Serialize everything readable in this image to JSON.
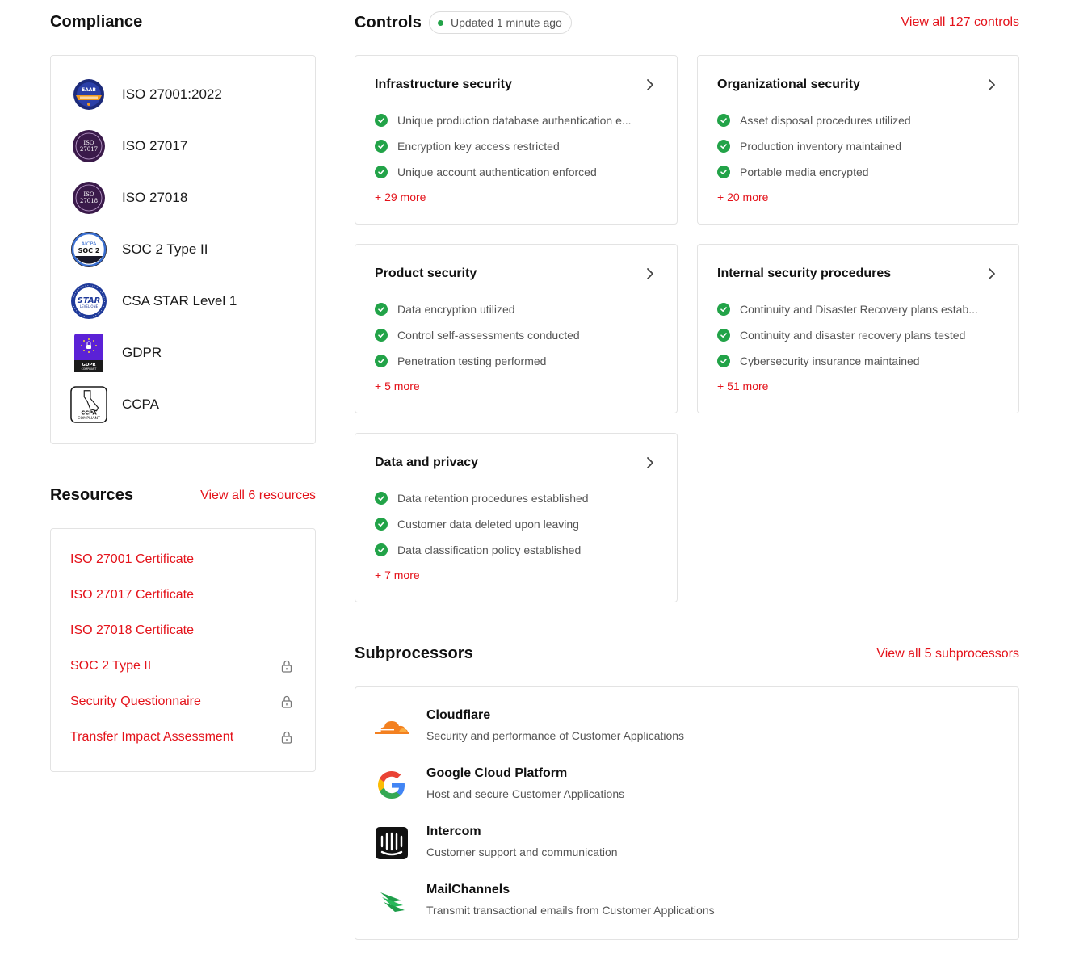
{
  "compliance": {
    "title": "Compliance",
    "items": [
      {
        "label": "ISO 27001:2022",
        "icon": "iso-27001-badge-icon"
      },
      {
        "label": "ISO 27017",
        "icon": "iso-27017-badge-icon"
      },
      {
        "label": "ISO 27018",
        "icon": "iso-27018-badge-icon"
      },
      {
        "label": "SOC 2 Type II",
        "icon": "soc2-badge-icon"
      },
      {
        "label": "CSA STAR Level 1",
        "icon": "csa-star-badge-icon"
      },
      {
        "label": "GDPR",
        "icon": "gdpr-badge-icon"
      },
      {
        "label": "CCPA",
        "icon": "ccpa-badge-icon"
      }
    ],
    "badges": {
      "iso27001_top": "EAAB",
      "iso27017_a": "ISO",
      "iso27017_b": "27017",
      "iso27018_a": "ISO",
      "iso27018_b": "27018",
      "soc_a": "AICPA",
      "soc_b": "SOC 2",
      "star_a": "STAR",
      "star_b": "LEVEL ONE",
      "gdpr_a": "GDPR",
      "gdpr_b": "COMPLIANT",
      "ccpa_a": "CCPA",
      "ccpa_b": "COMPLIANT"
    }
  },
  "resources": {
    "title": "Resources",
    "view_all": "View all 6 resources",
    "items": [
      {
        "label": "ISO 27001 Certificate",
        "locked": false
      },
      {
        "label": "ISO 27017 Certificate",
        "locked": false
      },
      {
        "label": "ISO 27018 Certificate",
        "locked": false
      },
      {
        "label": "SOC 2 Type II",
        "locked": true
      },
      {
        "label": "Security Questionnaire",
        "locked": true
      },
      {
        "label": "Transfer Impact Assessment",
        "locked": true
      }
    ]
  },
  "controls": {
    "title": "Controls",
    "updated": "Updated 1 minute ago",
    "view_all": "View all 127 controls",
    "cards": [
      {
        "title": "Infrastructure security",
        "items": [
          "Unique production database authentication e...",
          "Encryption key access restricted",
          "Unique account authentication enforced"
        ],
        "more": "+ 29 more"
      },
      {
        "title": "Organizational security",
        "items": [
          "Asset disposal procedures utilized",
          "Production inventory maintained",
          "Portable media encrypted"
        ],
        "more": "+ 20 more"
      },
      {
        "title": "Product security",
        "items": [
          "Data encryption utilized",
          "Control self-assessments conducted",
          "Penetration testing performed"
        ],
        "more": "+ 5 more"
      },
      {
        "title": "Internal security procedures",
        "items": [
          "Continuity and Disaster Recovery plans estab...",
          "Continuity and disaster recovery plans tested",
          "Cybersecurity insurance maintained"
        ],
        "more": "+ 51 more"
      },
      {
        "title": "Data and privacy",
        "items": [
          "Data retention procedures established",
          "Customer data deleted upon leaving",
          "Data classification policy established"
        ],
        "more": "+ 7 more"
      }
    ]
  },
  "subprocessors": {
    "title": "Subprocessors",
    "view_all": "View all 5 subprocessors",
    "items": [
      {
        "name": "Cloudflare",
        "desc": "Security and performance of Customer Applications",
        "icon": "cloudflare-logo-icon"
      },
      {
        "name": "Google Cloud Platform",
        "desc": "Host and secure Customer Applications",
        "icon": "google-logo-icon"
      },
      {
        "name": "Intercom",
        "desc": "Customer support and communication",
        "icon": "intercom-logo-icon"
      },
      {
        "name": "MailChannels",
        "desc": "Transmit transactional emails from Customer Applications",
        "icon": "mailchannels-logo-icon"
      }
    ]
  },
  "colors": {
    "accent": "#e4121a",
    "success": "#22a348",
    "border": "#e3e3e3"
  }
}
